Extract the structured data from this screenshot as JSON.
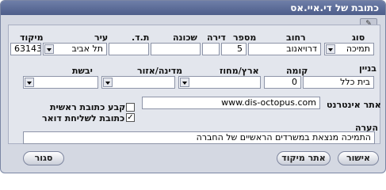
{
  "window": {
    "title": "כתובת של די.איי.אס"
  },
  "toolbar": {
    "tool_icon": "eraser-icon"
  },
  "row1": {
    "labels": {
      "type": "סוג",
      "street": "רחוב",
      "number": "מספר",
      "apartment": "דירה",
      "neighborhood": "שכונה",
      "pobox": "ת.ד.",
      "city": "עיר",
      "zip": "מיקוד"
    },
    "values": {
      "type": "תמיכה",
      "street": "דרויאנוב",
      "number": "5",
      "apartment": "",
      "neighborhood": "",
      "pobox": "",
      "city": "תל אביב",
      "zip": "63143"
    }
  },
  "row2": {
    "labels": {
      "building": "בניין",
      "floor": "קומה",
      "country": "ארץ/מחוז",
      "state": "מדינה/אזור",
      "continent": "יבשת"
    },
    "values": {
      "building": "בית כלל",
      "floor": "0",
      "country": "",
      "state": "",
      "continent": ""
    }
  },
  "website": {
    "label": "אתר אינטרנט",
    "value": "www.dis-octopus.com"
  },
  "checkboxes": {
    "primary": {
      "label": "קבע כתובת ראשית",
      "checked": false,
      "mark": ""
    },
    "mailing": {
      "label": "כתובת לשליחת דואר",
      "checked": true,
      "mark": "✓"
    }
  },
  "note": {
    "label": "הערה",
    "value": "התמיכה מנצאת במשרדים הראשיים של החברה"
  },
  "buttons": {
    "ok": "אישור",
    "find_zip": "אתר מיקוד",
    "close": "סגור"
  }
}
